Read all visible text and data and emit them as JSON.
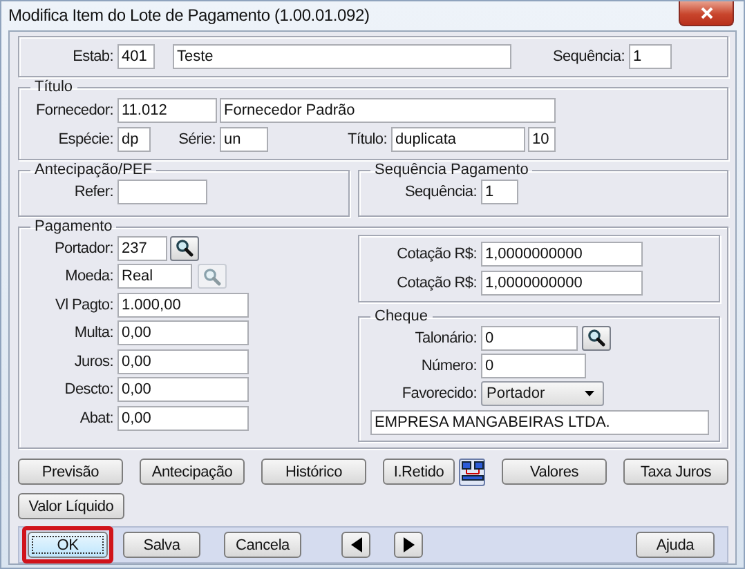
{
  "window": {
    "title": "Modifica Item do Lote de Pagamento (1.00.01.092)"
  },
  "header": {
    "estab_label": "Estab:",
    "estab": "401",
    "estab_name": "Teste",
    "sequencia_label": "Sequência:",
    "sequencia": "1"
  },
  "titulo": {
    "legend": "Título",
    "fornecedor_label": "Fornecedor:",
    "fornecedor": "11.012",
    "fornecedor_name": "Fornecedor Padrão",
    "especie_label": "Espécie:",
    "especie": "dp",
    "serie_label": "Série:",
    "serie": "un",
    "titulo_label": "Título:",
    "titulo": "duplicata",
    "parcela": "10"
  },
  "antecipacao": {
    "legend": "Antecipação/PEF",
    "refer_label": "Refer:"
  },
  "sequencia_pagamento": {
    "legend": "Sequência Pagamento",
    "sequencia_label": "Sequência:",
    "sequencia": "1"
  },
  "pagamento": {
    "legend": "Pagamento",
    "fields": [
      {
        "label": "Portador:",
        "value": "237",
        "kind": "lookup",
        "disabled": false
      },
      {
        "label": "Moeda:",
        "value": "Real",
        "kind": "lookup",
        "disabled": true
      },
      {
        "label": "Vl Pagto:",
        "value": "1.000,00",
        "kind": "text"
      },
      {
        "label": "Multa:",
        "value": "0,00",
        "kind": "text"
      },
      {
        "label": "Juros:",
        "value": "0,00",
        "kind": "text"
      },
      {
        "label": "Descto:",
        "value": "0,00",
        "kind": "text"
      },
      {
        "label": "Abat:",
        "value": "0,00",
        "kind": "text"
      }
    ],
    "cotacoes": [
      {
        "label": "Cotação R$:",
        "value": "1,0000000000"
      },
      {
        "label": "Cotação R$:",
        "value": "1,0000000000"
      }
    ],
    "cheque": {
      "legend": "Cheque",
      "talonario_label": "Talonário:",
      "talonario": "0",
      "numero_label": "Número:",
      "numero": "0",
      "favorecido_label": "Favorecido:",
      "favorecido": "Portador",
      "favorecido_name": "EMPRESA MANGABEIRAS LTDA."
    }
  },
  "action_buttons": [
    {
      "kind": "text",
      "label": "Previsão"
    },
    {
      "kind": "text",
      "label": "Antecipação"
    },
    {
      "kind": "text",
      "label": "Histórico"
    },
    {
      "kind": "text",
      "label": "I.Retido"
    },
    {
      "kind": "network"
    },
    {
      "kind": "text",
      "label": "Valores"
    },
    {
      "kind": "text",
      "label": "Taxa Juros"
    },
    {
      "kind": "text",
      "label": "Valor Líquido"
    }
  ],
  "bottom_buttons": [
    {
      "kind": "text",
      "label": "OK",
      "highlighted": true
    },
    {
      "kind": "text",
      "label": "Salva",
      "highlighted": false
    },
    {
      "kind": "text",
      "label": "Cancela",
      "highlighted": false
    },
    {
      "kind": "prev",
      "highlighted": false
    },
    {
      "kind": "next",
      "highlighted": false
    },
    {
      "kind": "text",
      "label": "Ajuda",
      "highlighted": false
    }
  ]
}
